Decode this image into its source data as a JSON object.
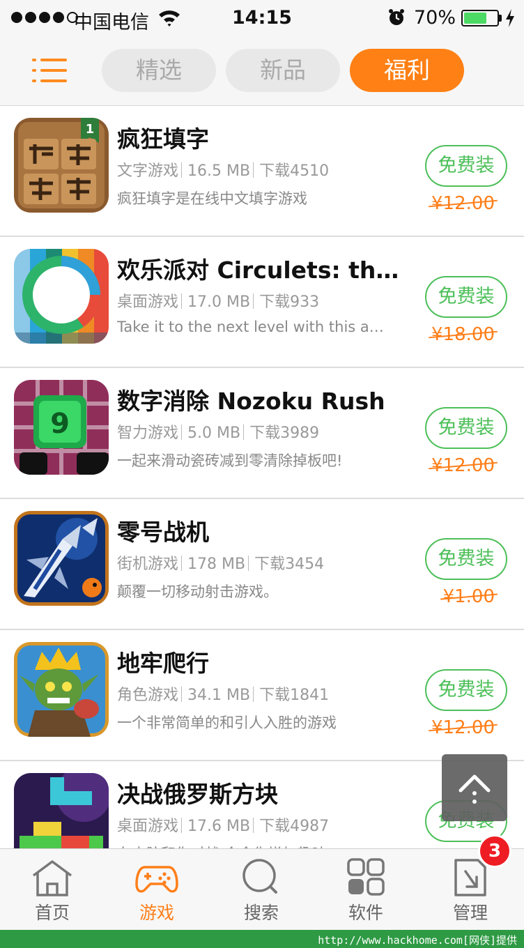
{
  "status_bar": {
    "carrier": "中国电信",
    "time": "14:15",
    "battery_text": "70%",
    "battery_level": 0.7,
    "battery_color": "#4cd964"
  },
  "nav": {
    "menu_icon": "list-icon",
    "tabs": [
      {
        "label": "精选",
        "active": false
      },
      {
        "label": "新品",
        "active": false
      },
      {
        "label": "福利",
        "active": true
      }
    ],
    "accent": "#ff8014"
  },
  "apps": [
    {
      "title": "疯狂填字",
      "category": "文字游戏",
      "size": "16.5 MB",
      "downloads": "下载4510",
      "desc": "疯狂填字是在线中文填字游戏",
      "button": "免费装",
      "price": "¥12.00",
      "icon": "crossword-icon",
      "icon_badge": "1"
    },
    {
      "title": "欢乐派对 Circulets: the…",
      "category": "桌面游戏",
      "size": "17.0 MB",
      "downloads": "下载933",
      "desc": "Take it to the next level with this a…",
      "button": "免费装",
      "price": "¥18.00",
      "icon": "circulets-icon"
    },
    {
      "title": "数字消除 Nozoku Rush",
      "category": "智力游戏",
      "size": "5.0 MB",
      "downloads": "下载3989",
      "desc": "一起来滑动瓷砖减到零清除掉板吧!",
      "button": "免费装",
      "price": "¥12.00",
      "icon": "nozoku-icon",
      "icon_text": "9"
    },
    {
      "title": "零号战机",
      "category": "街机游戏",
      "size": "178 MB",
      "downloads": "下载3454",
      "desc": "颠覆一切移动射击游戏。",
      "button": "免费装",
      "price": "¥1.00",
      "icon": "fighter-jet-icon"
    },
    {
      "title": "地牢爬行",
      "category": "角色游戏",
      "size": "34.1 MB",
      "downloads": "下载1841",
      "desc": "一个非常简单的和引人入胜的游戏",
      "button": "免费装",
      "price": "¥12.00",
      "icon": "goblin-king-icon"
    },
    {
      "title": "决战俄罗斯方块",
      "category": "桌面游戏",
      "size": "17.6 MB",
      "downloads": "下载4987",
      "desc": "在电脑和你对战,会令你增加趣味",
      "button": "免费装",
      "price": "",
      "icon": "tetris-blocks-icon"
    }
  ],
  "tab_bar": [
    {
      "label": "首页",
      "icon": "home-icon",
      "active": false
    },
    {
      "label": "游戏",
      "icon": "gamepad-icon",
      "active": true
    },
    {
      "label": "搜索",
      "icon": "search-icon",
      "active": false
    },
    {
      "label": "软件",
      "icon": "apps-grid-icon",
      "active": false
    },
    {
      "label": "管理",
      "icon": "manage-download-icon",
      "active": false
    }
  ],
  "manage_badge": "3",
  "scroll_top_icon": "chevron-up-icon",
  "colors": {
    "install_green": "#4cbf58",
    "price_orange": "#ff7f1a",
    "badge_red": "#ee1d23"
  },
  "footer": "http://www.hackhome.com[网侠]提供"
}
